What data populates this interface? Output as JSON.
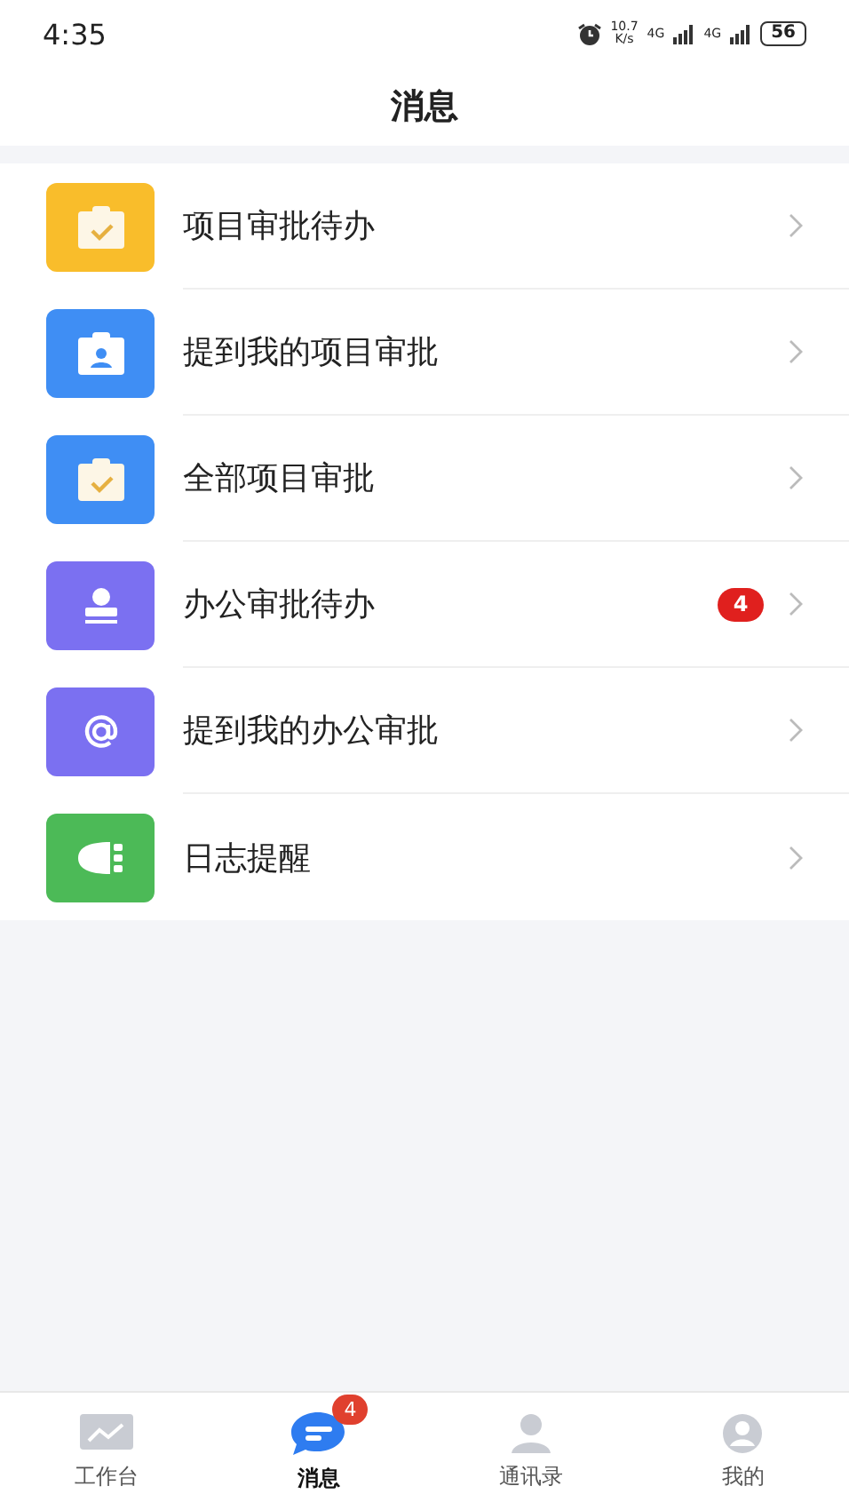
{
  "status_bar": {
    "time": "4:35",
    "speed_value": "10.7",
    "speed_unit": "K/s",
    "network_1": "4G",
    "network_2": "4G",
    "battery": "56"
  },
  "header": {
    "title": "消息"
  },
  "items": [
    {
      "label": "项目审批待办",
      "kind": "clipboard-check",
      "color": "#f9bd2b"
    },
    {
      "label": "提到我的项目审批",
      "kind": "badge-person",
      "color": "#3f8ef4"
    },
    {
      "label": "全部项目审批",
      "kind": "clipboard-check",
      "color": "#3f8ef4"
    },
    {
      "label": "办公审批待办",
      "kind": "stamp",
      "color": "#7b70f1",
      "badge": "4"
    },
    {
      "label": "提到我的办公审批",
      "kind": "at",
      "color": "#7b70f1"
    },
    {
      "label": "日志提醒",
      "kind": "plug",
      "color": "#4cba57"
    }
  ],
  "tabs": [
    {
      "label": "工作台",
      "kind": "chart",
      "selected": false
    },
    {
      "label": "消息",
      "kind": "chat",
      "selected": true,
      "badge": "4"
    },
    {
      "label": "通讯录",
      "kind": "contacts",
      "selected": false
    },
    {
      "label": "我的",
      "kind": "person",
      "selected": false
    }
  ]
}
